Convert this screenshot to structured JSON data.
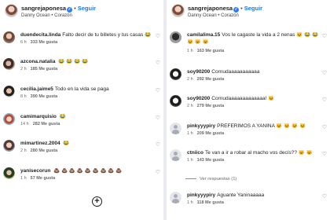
{
  "left": {
    "header": {
      "username": "sangrejaponesa",
      "follow_label": "Seguir",
      "music": "Danny Ocean",
      "song": "Corazón"
    },
    "comments": [
      {
        "username": "duendecita.linda",
        "text": "Falto decir de tu billetes y tus casas",
        "emoji": "😂",
        "time": "6 h",
        "likes": "333 Me gusta"
      },
      {
        "username": "azcona.natalia",
        "text": "",
        "emoji": "😂 😂 😂 😂",
        "time": "2 h",
        "likes": "185 Me gusta"
      },
      {
        "username": "cecilia.jaime5",
        "text": "Todo en la vida se paga",
        "emoji": "",
        "time": "8 h",
        "likes": "390 Me gusta"
      },
      {
        "username": "camimarquisio",
        "text": "",
        "emoji": "😂",
        "time": "14 h",
        "likes": "282 Me gusta"
      },
      {
        "username": "mimartinez.2004",
        "text": "",
        "emoji": "😂",
        "time": "2 h",
        "likes": "280 Me gusta"
      },
      {
        "username": "yanisecorun",
        "text": "",
        "emoji": "💩 💩 💩 💩 💩 💩 💩 💩 💩",
        "time": "1 h",
        "likes": "57 Me gusta"
      }
    ],
    "add_symbol": "+"
  },
  "right": {
    "header": {
      "username": "sangrejaponesa",
      "follow_label": "Seguir",
      "music": "Danny Ocean",
      "song": "Corazón"
    },
    "comments": [
      {
        "username": "camilalima.15",
        "text": "Vos le cagaste la vida a 2 nenas",
        "emoji": "🐱 😂 😂",
        "emoji2": "🐱 🐱 🐱",
        "time": "1 h",
        "likes": "163 Me gusta"
      },
      {
        "username": "soy90200",
        "text": "Cornudaaaaaaaaaaa",
        "emoji": "",
        "time": "2 h",
        "likes": "292 Me gusta"
      },
      {
        "username": "soy90200",
        "text": "Cornudaaaaaaaaaaaaa!",
        "emoji": "🐱",
        "time": "2 h",
        "likes": "279 Me gusta"
      },
      {
        "username": "pinkyyypiry",
        "text": "PREFERIMOS A YANINA",
        "emoji": "🐱 🐱 🐱 🐱",
        "time": "1 h",
        "likes": "209 Me gusta"
      },
      {
        "username": "ctniico",
        "text": "Te van a ir a robar al macho vos decís??",
        "emoji": "🐱 🐱",
        "time": "1 h",
        "likes": "143 Me gusta"
      },
      {
        "username": "pinkyyypiry",
        "text": "Aguante Yaninaaaaa",
        "emoji": "",
        "time": "1 h",
        "likes": "118 Me gusta"
      }
    ],
    "view_replies": "Ver respuestas (1)"
  },
  "labels": {
    "reply": "Responder"
  },
  "heart_symbol": "♡"
}
